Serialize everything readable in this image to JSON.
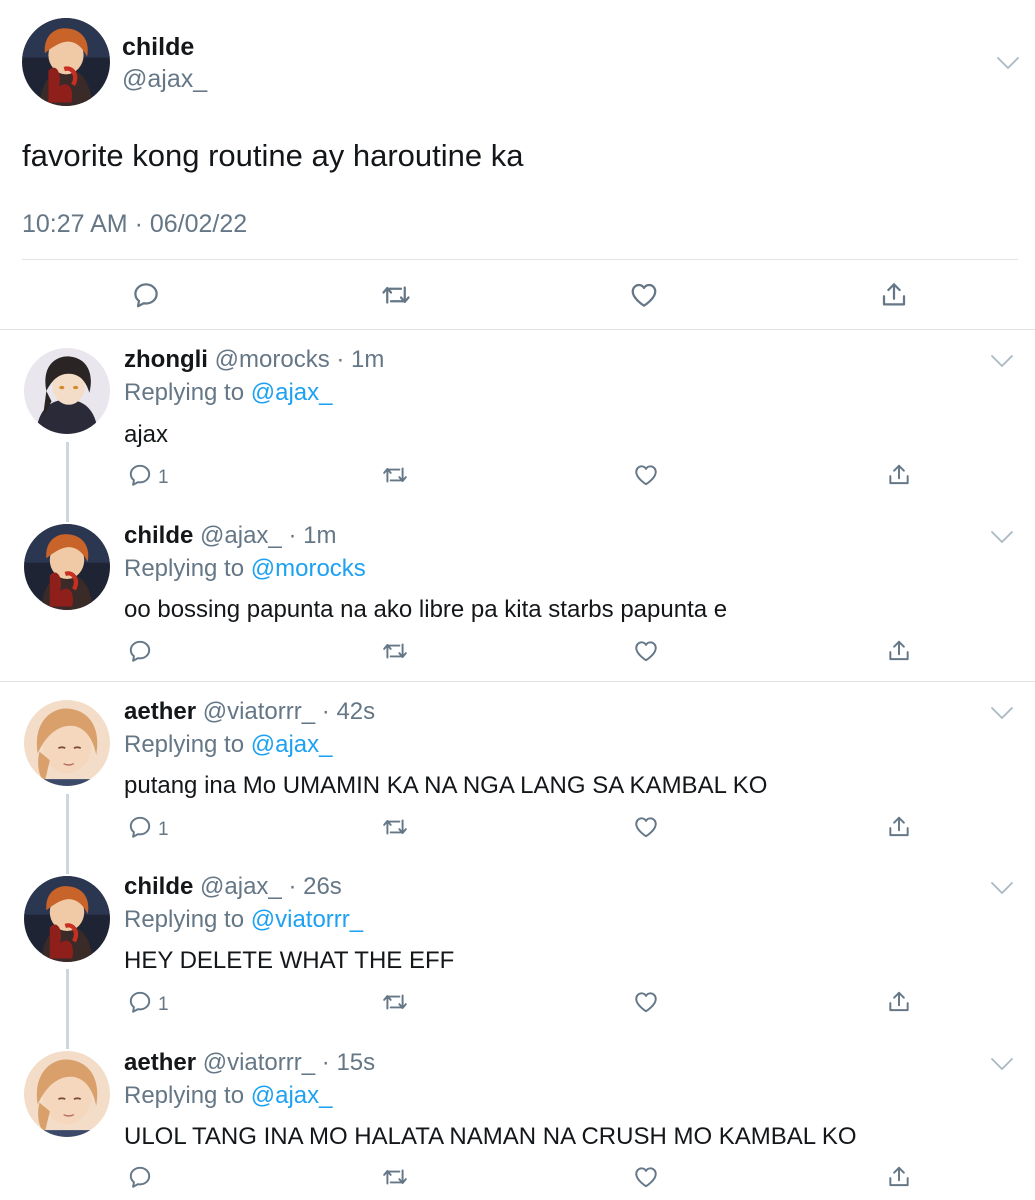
{
  "main_tweet": {
    "name": "childe",
    "handle": "@ajax_",
    "text": "favorite kong routine ay haroutine ka",
    "timestamp": "10:27 AM · 06/02/22",
    "icons": [
      "reply-icon",
      "retweet-icon",
      "like-icon",
      "share-icon",
      "chevron-down-icon"
    ]
  },
  "replies": [
    {
      "name": "zhongli",
      "handle": "@morocks",
      "time": "1m",
      "replying_prefix": "Replying to ",
      "replying_to": "@ajax_",
      "text": "ajax",
      "reply_count": "1"
    },
    {
      "name": "childe",
      "handle": "@ajax_",
      "time": "1m",
      "replying_prefix": "Replying to ",
      "replying_to": "@morocks",
      "text": "oo bossing papunta na ako libre pa kita starbs papunta e",
      "reply_count": ""
    },
    {
      "name": "aether",
      "handle": "@viatorrr_",
      "time": "42s",
      "replying_prefix": "Replying to ",
      "replying_to": "@ajax_",
      "text": "putang ina Mo UMAMIN KA NA NGA LANG SA KAMBAL KO",
      "reply_count": "1"
    },
    {
      "name": "childe",
      "handle": "@ajax_",
      "time": "26s",
      "replying_prefix": "Replying to ",
      "replying_to": "@viatorrr_",
      "text": "HEY DELETE WHAT THE EFF",
      "reply_count": "1"
    },
    {
      "name": "aether",
      "handle": "@viatorrr_",
      "time": "15s",
      "replying_prefix": "Replying to ",
      "replying_to": "@ajax_",
      "text": "ULOL TANG INA MO HALATA NAMAN NA CRUSH MO KAMBAL KO",
      "reply_count": ""
    }
  ],
  "separator": " · ",
  "colors": {
    "text": "#14171a",
    "secondary": "#657786",
    "link": "#1da1f2",
    "divider": "#dfe3e6",
    "thread_line": "#ccd6dd"
  }
}
